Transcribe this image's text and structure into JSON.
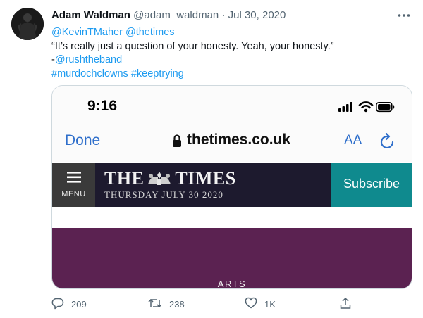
{
  "tweet": {
    "display_name": "Adam Waldman",
    "handle": "@adam_waldman",
    "separator": "·",
    "date": "Jul 30, 2020",
    "more_icon": "more-horizontal-icon",
    "mentions": [
      "@KevinTMaher",
      "@thetimes"
    ],
    "quote_text": "“It’s really just a question of your honesty. Yeah, your honesty.”",
    "attribution_prefix": "-",
    "attribution_mention": "@rushtheband",
    "hashtags": [
      "#murdochclowns",
      "#keeptrying"
    ]
  },
  "screenshot": {
    "status_time": "9:16",
    "done_label": "Done",
    "domain": "thetimes.co.uk",
    "text_size_label": "AA",
    "menu_label": "MENU",
    "masthead_left": "THE",
    "masthead_right": "TIMES",
    "masthead_date": "THURSDAY JULY 30 2020",
    "subscribe_label": "Subscribe",
    "section_label": "ARTS"
  },
  "actions": {
    "reply_count": "209",
    "retweet_count": "238",
    "like_count": "1K",
    "icons": [
      "reply-icon",
      "retweet-icon",
      "like-icon",
      "share-icon"
    ]
  },
  "colors": {
    "link": "#1d9bf0",
    "secondary_text": "#536471",
    "masthead_bg": "#1d1a2e",
    "subscribe_bg": "#0f8a8e",
    "arts_bg": "#5b2251",
    "ios_blue": "#2f6fcb"
  }
}
